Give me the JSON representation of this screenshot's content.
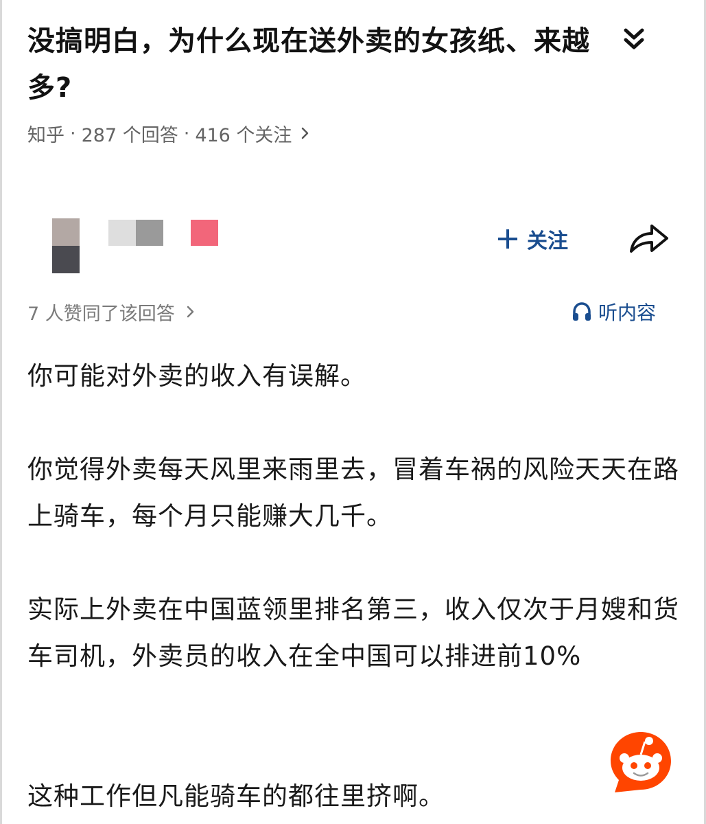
{
  "question": {
    "title": "没搞明白，为什么现在送外卖的女孩纸、来越多?",
    "collapse_icon": "double-chevron-down-icon"
  },
  "meta": {
    "source": "知乎",
    "separator": "·",
    "answers": "287 个回答",
    "followers": "416 个关注",
    "chevron_icon": "chevron-right-icon"
  },
  "answer": {
    "follow_label": "关注",
    "share_icon": "share-icon",
    "agree_text": "7 人赞同了该回答",
    "listen_label": "听内容",
    "listen_icon": "headphones-icon",
    "paragraphs": [
      "你可能对外卖的收入有误解。",
      "你觉得外卖每天风里来雨里去，冒着车祸的风险天天在路上骑车，每个月只能赚大几千。",
      "实际上外卖在中国蓝领里排名第三，收入仅次于月嫂和货车司机，外卖员的收入在全中国可以排进前10%",
      "这种工作但凡能骑车的都往里挤啊。"
    ]
  },
  "colors": {
    "accent": "#1a4d8f",
    "reddit": "#ff4500",
    "avatar_pink": "#f2667a"
  },
  "watermark_icon": "reddit-snoo-icon"
}
